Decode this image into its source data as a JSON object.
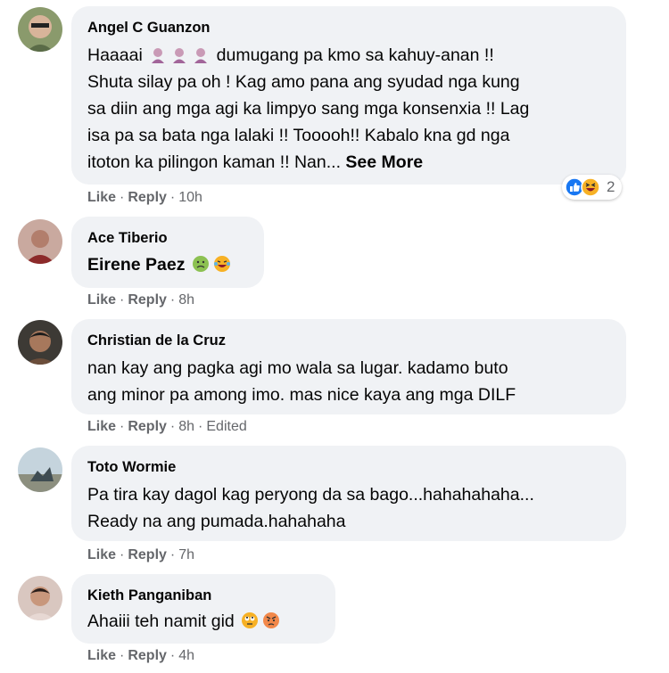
{
  "comments": [
    {
      "author": "Angel C Guanzon",
      "lines": [
        "Haaaai",
        "dumugang pa kmo sa kahuy-anan !!",
        "Shuta silay pa oh ! Kag amo pana ang syudad nga kung",
        "sa diin ang mga agi ka limpyo sang mga konsenxia !! Lag",
        "isa pa sa bata nga lalaki !! Tooooh!! Kabalo kna gd nga",
        "itoton ka pilingon kaman !! Nan..."
      ],
      "see_more": "See More",
      "like": "Like",
      "reply": "Reply",
      "time": "10h",
      "reaction_count": "2",
      "reaction_icons": [
        "like-icon",
        "laughing-face-icon"
      ],
      "inline_emoji": [
        "woman-emoji",
        "woman-emoji",
        "woman-emoji"
      ]
    },
    {
      "author": "Ace Tiberio",
      "mention": "Eirene Paez",
      "inline_emoji": [
        "nauseated-face-emoji",
        "tears-of-joy-emoji"
      ],
      "like": "Like",
      "reply": "Reply",
      "time": "8h"
    },
    {
      "author": "Christian de la Cruz",
      "lines": [
        "nan kay ang pagka agi mo wala sa lugar. kadamo buto",
        "ang minor pa among imo. mas nice kaya ang mga DILF"
      ],
      "like": "Like",
      "reply": "Reply",
      "time": "8h",
      "edited": "Edited"
    },
    {
      "author": "Toto Wormie",
      "lines": [
        "Pa tira kay dagol kag peryong da sa bago...hahahahaha...",
        "Ready na ang pumada.hahahaha"
      ],
      "like": "Like",
      "reply": "Reply",
      "time": "7h"
    },
    {
      "author": "Kieth Panganiban",
      "lines": [
        "Ahaiii teh namit gid"
      ],
      "inline_emoji": [
        "rolling-eyes-emoji",
        "angry-face-emoji"
      ],
      "like": "Like",
      "reply": "Reply",
      "time": "4h"
    }
  ],
  "colors": {
    "bubble": "#f0f2f5",
    "meta_text": "#65676b",
    "like_blue": "#1877f2",
    "haha_yellow": "#f7b125"
  }
}
